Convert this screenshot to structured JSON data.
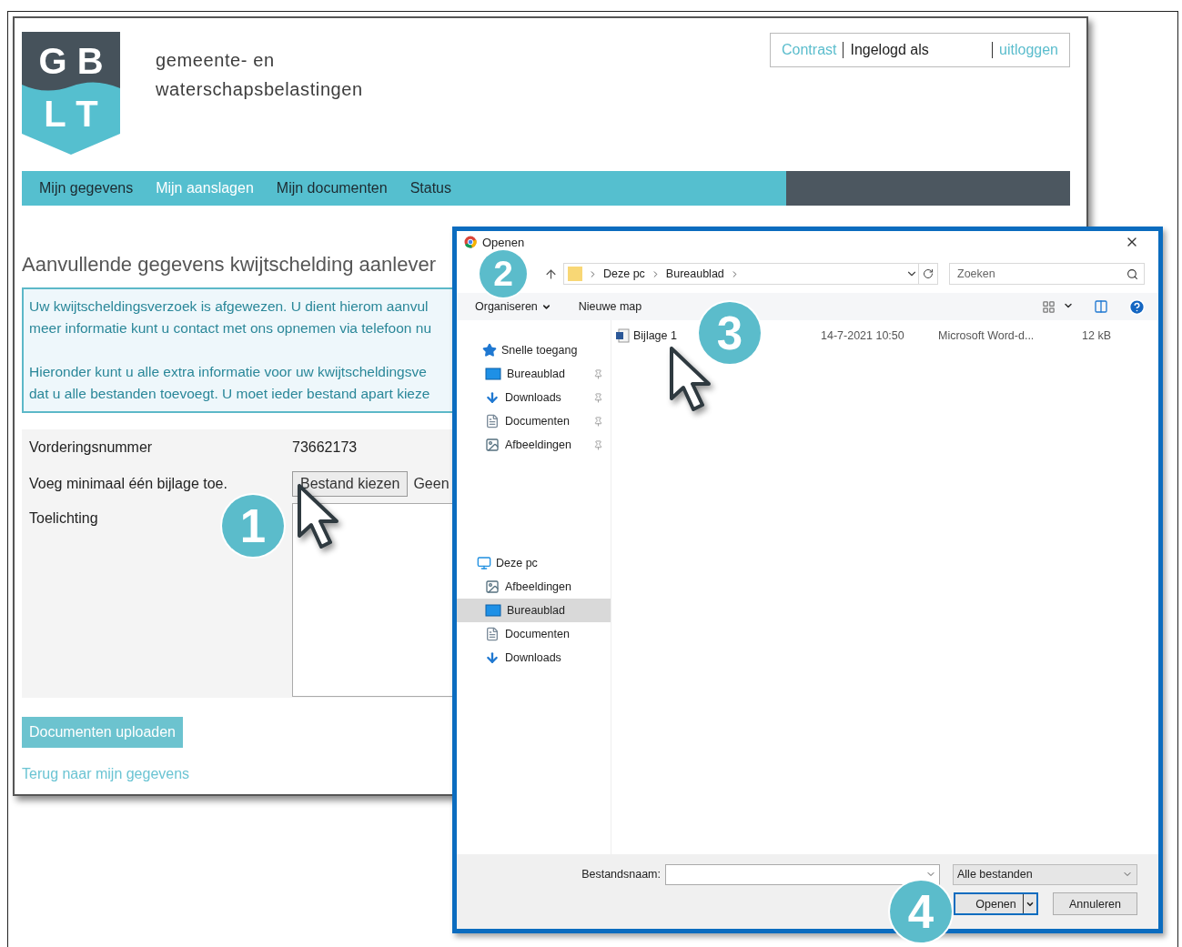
{
  "website": {
    "logo": {
      "top": "G B",
      "bottom": "L T"
    },
    "title_lines": [
      "gemeente- en",
      "waterschapsbelastingen"
    ],
    "account_bar": {
      "contrast_link": "Contrast",
      "logged_in_label": "Ingelogd als",
      "logout_link": "uitloggen"
    },
    "nav": [
      {
        "label": "Mijn gegevens",
        "selected": false
      },
      {
        "label": "Mijn aanslagen",
        "selected": true
      },
      {
        "label": "Mijn documenten",
        "selected": false
      },
      {
        "label": "Status",
        "selected": false
      }
    ],
    "heading": "Aanvullende gegevens kwijtschelding aanlever",
    "notice": [
      [
        "Uw kwijtscheldingsverzoek is afgewezen. U dient hierom aanvul",
        "meer informatie kunt u contact met ons opnemen via telefoon nu"
      ],
      [
        "Hieronder kunt u alle extra informatie voor uw kwijtscheldingsve",
        "dat u alle bestanden toevoegt. U moet ieder bestand apart kieze"
      ]
    ],
    "form": [
      {
        "kind": "text",
        "label": "Vorderingsnummer",
        "value": "73662173"
      },
      {
        "kind": "file",
        "label": "Voeg minimaal één bijlage toe.",
        "button": "Bestand kiezen",
        "status": "Geen"
      },
      {
        "kind": "textarea",
        "label": "Toelichting"
      }
    ],
    "upload_button": "Documenten uploaden",
    "back_link": "Terug naar mijn gegevens"
  },
  "dialog": {
    "title": "Openen",
    "breadcrumb": [
      "Deze pc",
      "Bureaublad"
    ],
    "search": {
      "placeholder": "Zoeken"
    },
    "toolbar": {
      "organize": "Organiseren",
      "new_folder": "Nieuwe map"
    },
    "sidebar": [
      {
        "label": "Snelle toegang",
        "kind": "star",
        "children": [
          {
            "label": "Bureaublad",
            "kind": "desktop",
            "pinned": true,
            "selected": false
          },
          {
            "label": "Downloads",
            "kind": "download",
            "pinned": true,
            "selected": false
          },
          {
            "label": "Documenten",
            "kind": "document",
            "pinned": true,
            "selected": false
          },
          {
            "label": "Afbeeldingen",
            "kind": "pictures",
            "pinned": true,
            "selected": false
          }
        ]
      },
      {
        "label": "Deze pc",
        "kind": "pc",
        "children": [
          {
            "label": "Afbeeldingen",
            "kind": "pictures",
            "pinned": false,
            "selected": false
          },
          {
            "label": "Bureaublad",
            "kind": "desktop",
            "pinned": false,
            "selected": true
          },
          {
            "label": "Documenten",
            "kind": "document",
            "pinned": false,
            "selected": false
          },
          {
            "label": "Downloads",
            "kind": "download",
            "pinned": false,
            "selected": false
          }
        ]
      }
    ],
    "files": [
      {
        "name": "Bijlage 1",
        "date": "14-7-2021 10:50",
        "type": "Microsoft Word-d...",
        "size": "12 kB"
      }
    ],
    "filename_label": "Bestandsnaam:",
    "filter": "Alle bestanden",
    "open_button": "Openen",
    "cancel_button": "Annuleren"
  },
  "callouts": [
    "1",
    "2",
    "3",
    "4"
  ]
}
